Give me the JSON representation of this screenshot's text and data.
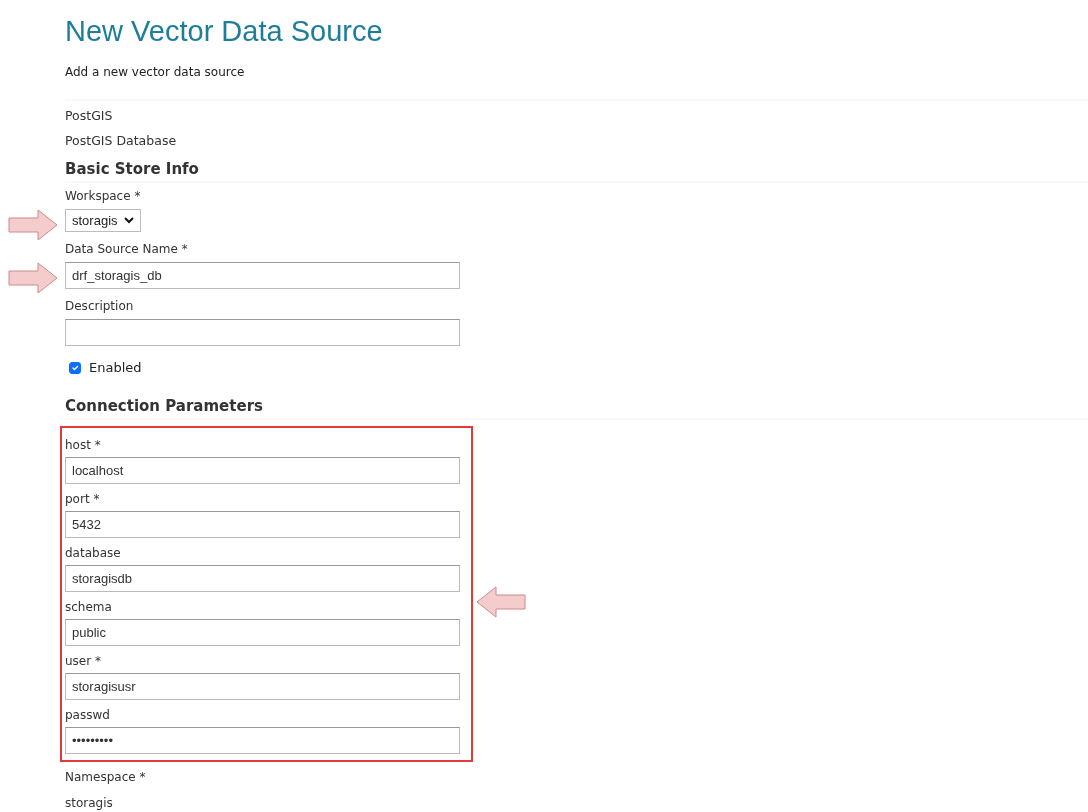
{
  "title": "New Vector Data Source",
  "subtitle": "Add a new vector data source",
  "store": {
    "type": "PostGIS",
    "description": "PostGIS Database"
  },
  "basic_store_info": {
    "heading": "Basic Store Info",
    "fields": [
      {
        "kind": "select",
        "label": "Workspace *",
        "value": "storagis",
        "arrow": true
      },
      {
        "kind": "text",
        "label": "Data Source Name *",
        "value": "drf_storagis_db",
        "arrow": true
      },
      {
        "kind": "text",
        "label": "Description",
        "arrow": false
      }
    ],
    "enabled": {
      "label": "Enabled",
      "checked": true
    }
  },
  "connection_parameters": {
    "heading": "Connection Parameters",
    "highlighted": true,
    "fields": [
      {
        "label": "host *",
        "value": "localhost"
      },
      {
        "label": "port *",
        "value": "5432"
      },
      {
        "label": "database",
        "value": "storagisdb"
      },
      {
        "label": "schema",
        "value": "public"
      },
      {
        "label": "user *",
        "value": "storagisusr"
      },
      {
        "label": "passwd",
        "value": "•••••••••"
      }
    ]
  },
  "namespace": {
    "label": "Namespace *",
    "value": "storagis"
  }
}
